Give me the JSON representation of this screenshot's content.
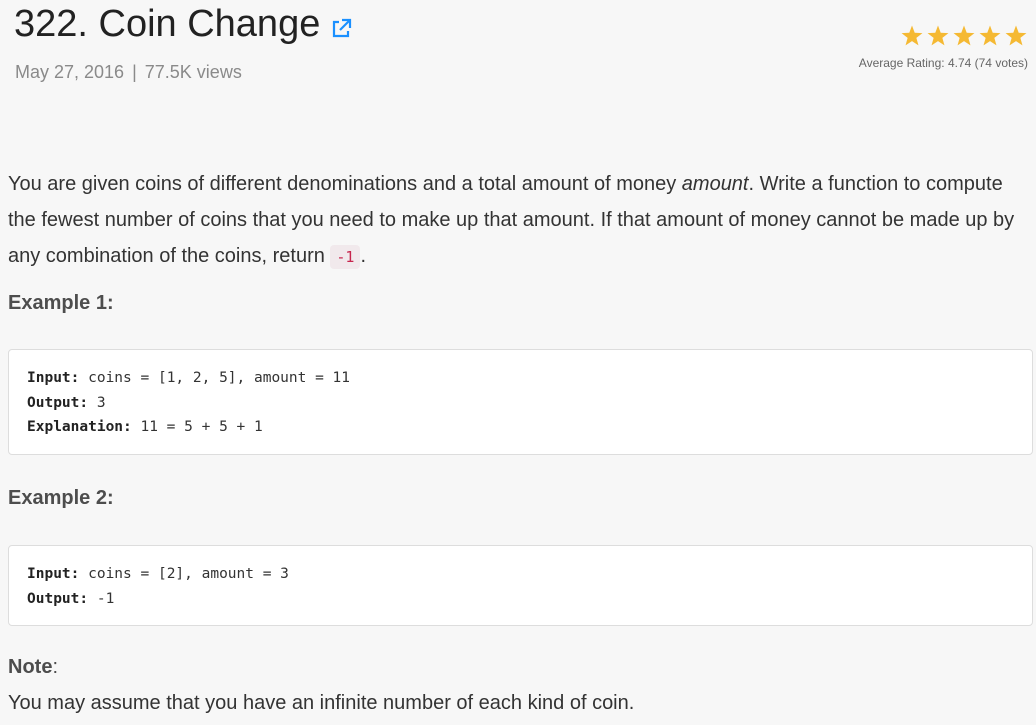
{
  "article": {
    "title": "322. Coin Change",
    "date": "May 27, 2016",
    "separator": "|",
    "views": "77.5K views"
  },
  "rating": {
    "value": 4.74,
    "stars_filled": 5,
    "star_color": "#f5b933",
    "text": "Average Rating: 4.74 (74 votes)"
  },
  "icons": {
    "external_link": "external-link-icon",
    "star": "star-icon"
  },
  "description": {
    "part1": "You are given coins of different denominations and a total amount of money ",
    "amount_word": "amount",
    "part2": ". Write a function to compute the fewest number of coins that you need to make up that amount. If that amount of money cannot be made up by any combination of the coins, return ",
    "return_value": "-1",
    "part3": "."
  },
  "example1": {
    "heading": "Example 1:",
    "lines": [
      {
        "label": "Input:",
        "value": " coins = [1, 2, 5], amount = 11"
      },
      {
        "label": "Output:",
        "value": " 3"
      },
      {
        "label": "Explanation:",
        "value": " 11 = 5 + 5 + 1"
      }
    ]
  },
  "example2": {
    "heading": "Example 2:",
    "lines": [
      {
        "label": "Input:",
        "value": " coins = [2], amount = 3"
      },
      {
        "label": "Output:",
        "value": " -1"
      }
    ]
  },
  "note": {
    "label": "Note",
    "colon": ":",
    "text": "You may assume that you have an infinite number of each kind of coin."
  },
  "colors": {
    "link_blue": "#1a90ff",
    "code_red": "#c7254e"
  }
}
